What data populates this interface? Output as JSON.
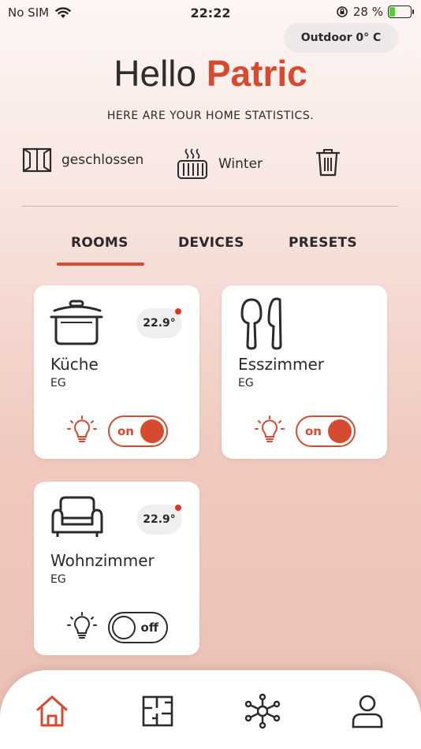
{
  "status_bar": {
    "carrier": "No SIM",
    "time": "22:22",
    "battery": "28 %",
    "battery_level": 0.28
  },
  "outdoor": {
    "label": "Outdoor 0° C"
  },
  "greeting": {
    "hello": "Hello",
    "name": "Patric"
  },
  "subtitle": "HERE ARE YOUR HOME STATISTICS.",
  "stats": {
    "window_status": "geschlossen",
    "heating_mode": "Winter",
    "window_icon": "window-icon",
    "heater_icon": "radiator-icon",
    "trash_icon": "trash-icon"
  },
  "tabs": [
    {
      "label": "ROOMS",
      "active": true
    },
    {
      "label": "DEVICES",
      "active": false
    },
    {
      "label": "PRESETS",
      "active": false
    }
  ],
  "rooms": [
    {
      "name": "Küche",
      "floor": "EG",
      "temp": "22.9°",
      "light": "on",
      "icon": "pot-icon",
      "has_alert": true
    },
    {
      "name": "Esszimmer",
      "floor": "EG",
      "temp": "",
      "light": "on",
      "icon": "cutlery-icon",
      "has_alert": false
    },
    {
      "name": "Wohnzimmer",
      "floor": "EG",
      "temp": "22.9°",
      "light": "off",
      "icon": "armchair-icon",
      "has_alert": true
    }
  ],
  "bottom_nav": [
    {
      "icon": "home-icon",
      "active": true
    },
    {
      "icon": "floorplan-icon",
      "active": false
    },
    {
      "icon": "network-icon",
      "active": false
    },
    {
      "icon": "profile-icon",
      "active": false
    }
  ],
  "colors": {
    "accent": "#d64a2f",
    "dark": "#2a2a2a",
    "alert": "#e0342a",
    "battery": "#4cd137"
  }
}
